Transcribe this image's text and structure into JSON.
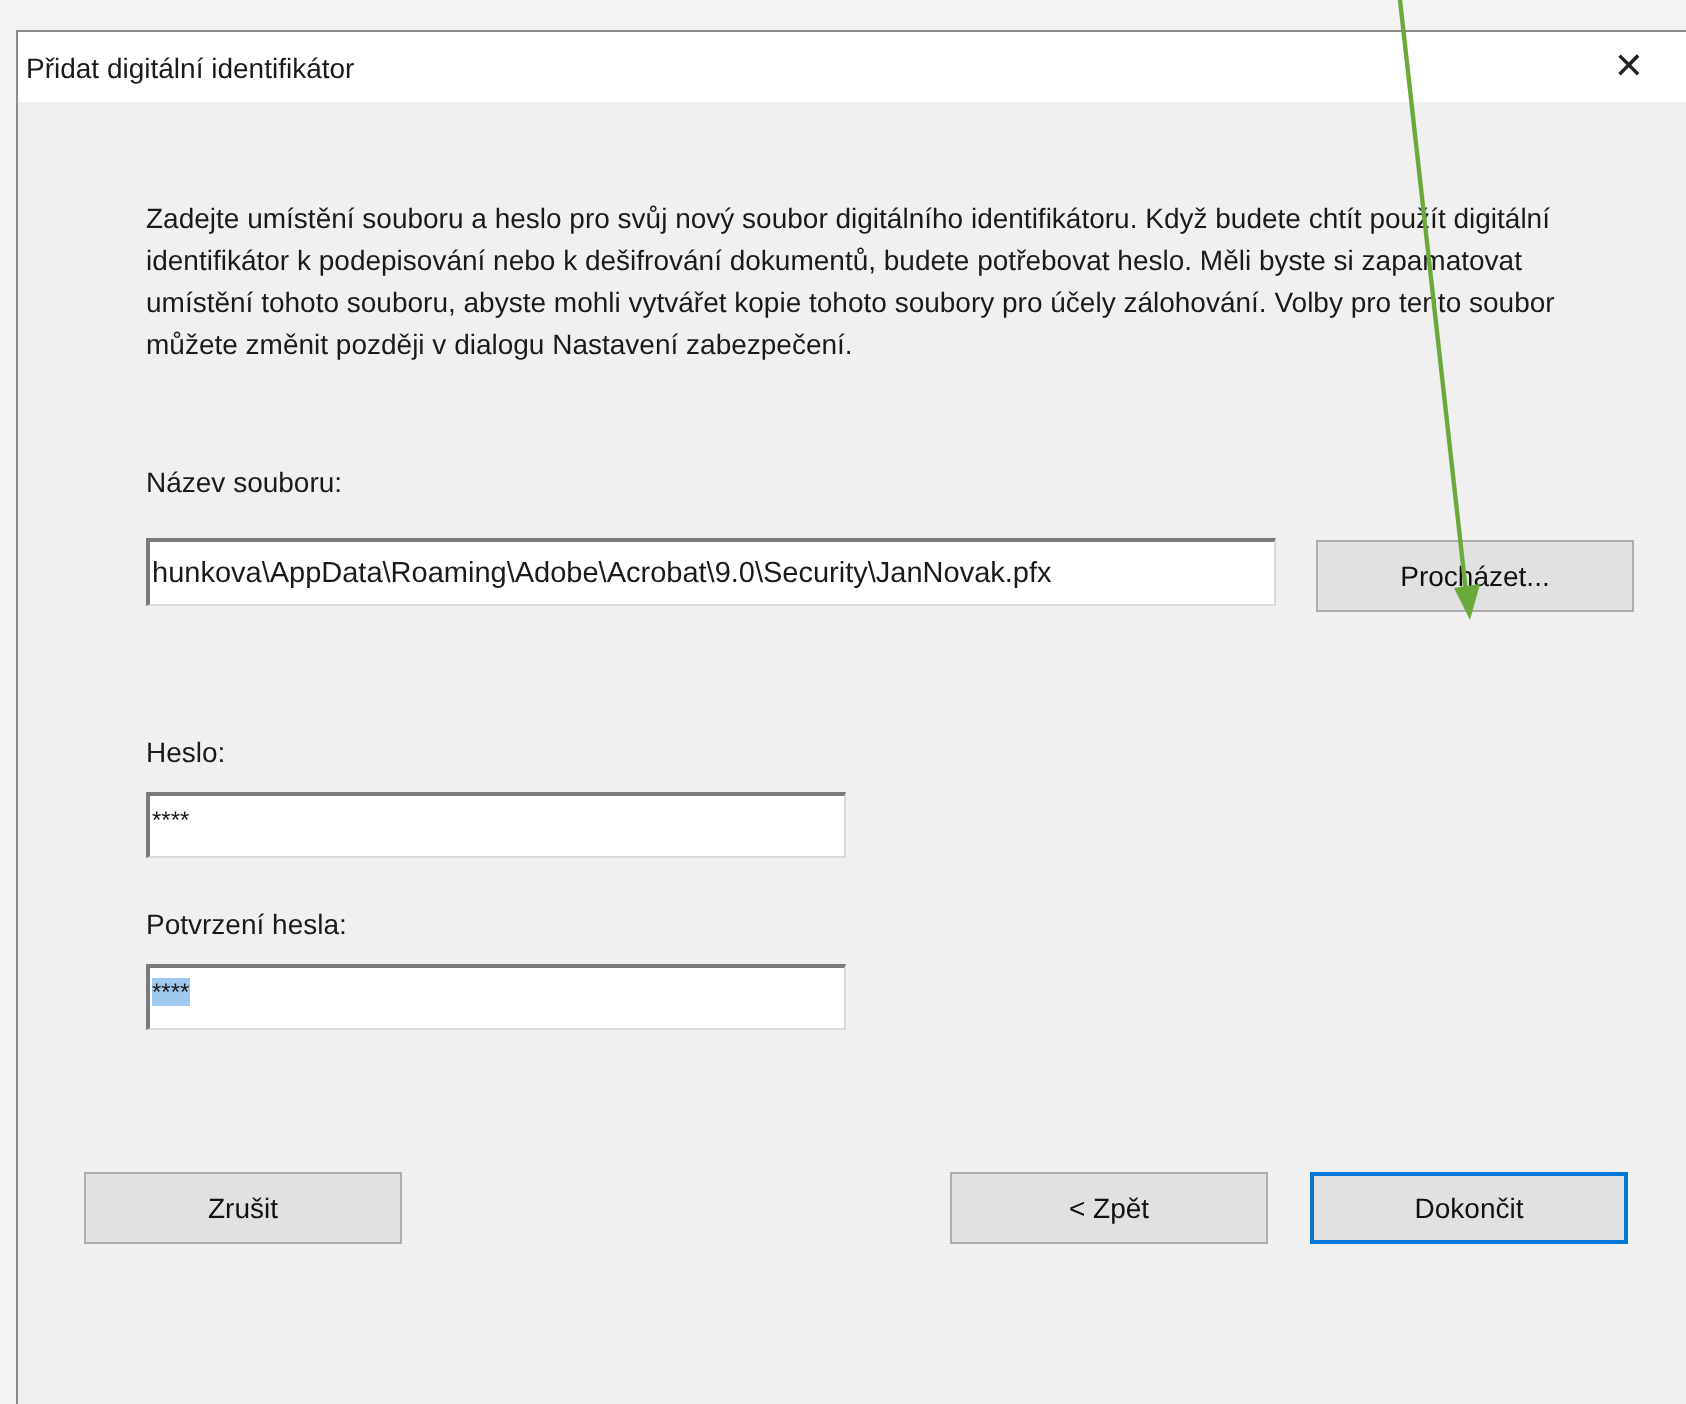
{
  "window": {
    "title": "Přidat digitální identifikátor",
    "close": "✕"
  },
  "description": "Zadejte umístění souboru a heslo pro svůj nový soubor digitálního identifikátoru. Když budete chtít použít digitální identifikátor k podepisování nebo k dešifrování dokumentů, budete potřebovat heslo. Měli byste si zapamatovat umístění tohoto souboru, abyste mohli vytvářet kopie tohoto soubory pro účely zálohování. Volby pro tento soubor můžete změnit později v dialogu Nastavení zabezpečení.",
  "file": {
    "label": "Název souboru:",
    "value": "hunkova\\AppData\\Roaming\\Adobe\\Acrobat\\9.0\\Security\\JanNovak.pfx",
    "browse": "Procházet..."
  },
  "password": {
    "label": "Heslo:",
    "value": "****",
    "text_selected": false
  },
  "confirm": {
    "label": "Potvrzení hesla:",
    "value": "****",
    "text_selected": true
  },
  "buttons": [
    {
      "label": "Zrušit",
      "default": false
    },
    {
      "label": "< Zpět",
      "default": false
    },
    {
      "label": "Dokončit",
      "default": true
    }
  ]
}
